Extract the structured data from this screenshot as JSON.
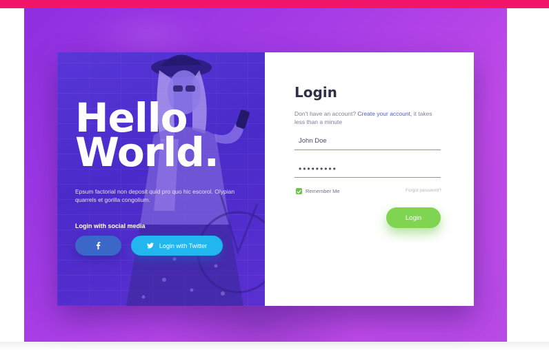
{
  "colors": {
    "top_bar": "#f2156a",
    "background_purple": "#a33be6",
    "hero_overlay": "#4a2bc9",
    "facebook": "#3a67c8",
    "twitter": "#22b6ef",
    "login_button": "#7fd451",
    "link": "#4a5be0",
    "checkbox": "#6cc44a"
  },
  "hero": {
    "title_line1": "Hello",
    "title_line2": "World.",
    "text": "Epsum factorial non deposit quid pro quo hic escorol. Olypian quarrels et gorilla congolium.",
    "social_heading": "Login with social media",
    "facebook_icon": "facebook-icon",
    "twitter_icon": "twitter-icon",
    "twitter_label": "Login with Twitter"
  },
  "login": {
    "title": "Login",
    "subtitle_prefix": "Don't have an account? ",
    "create_account_link": "Create your account",
    "subtitle_suffix": ", it takes less than a minute",
    "username_value": "John Doe",
    "password_value": "•••••••••",
    "remember_label": "Remember Me",
    "remember_checked": true,
    "forgot_label": "Forgot password?",
    "submit_label": "Login"
  }
}
